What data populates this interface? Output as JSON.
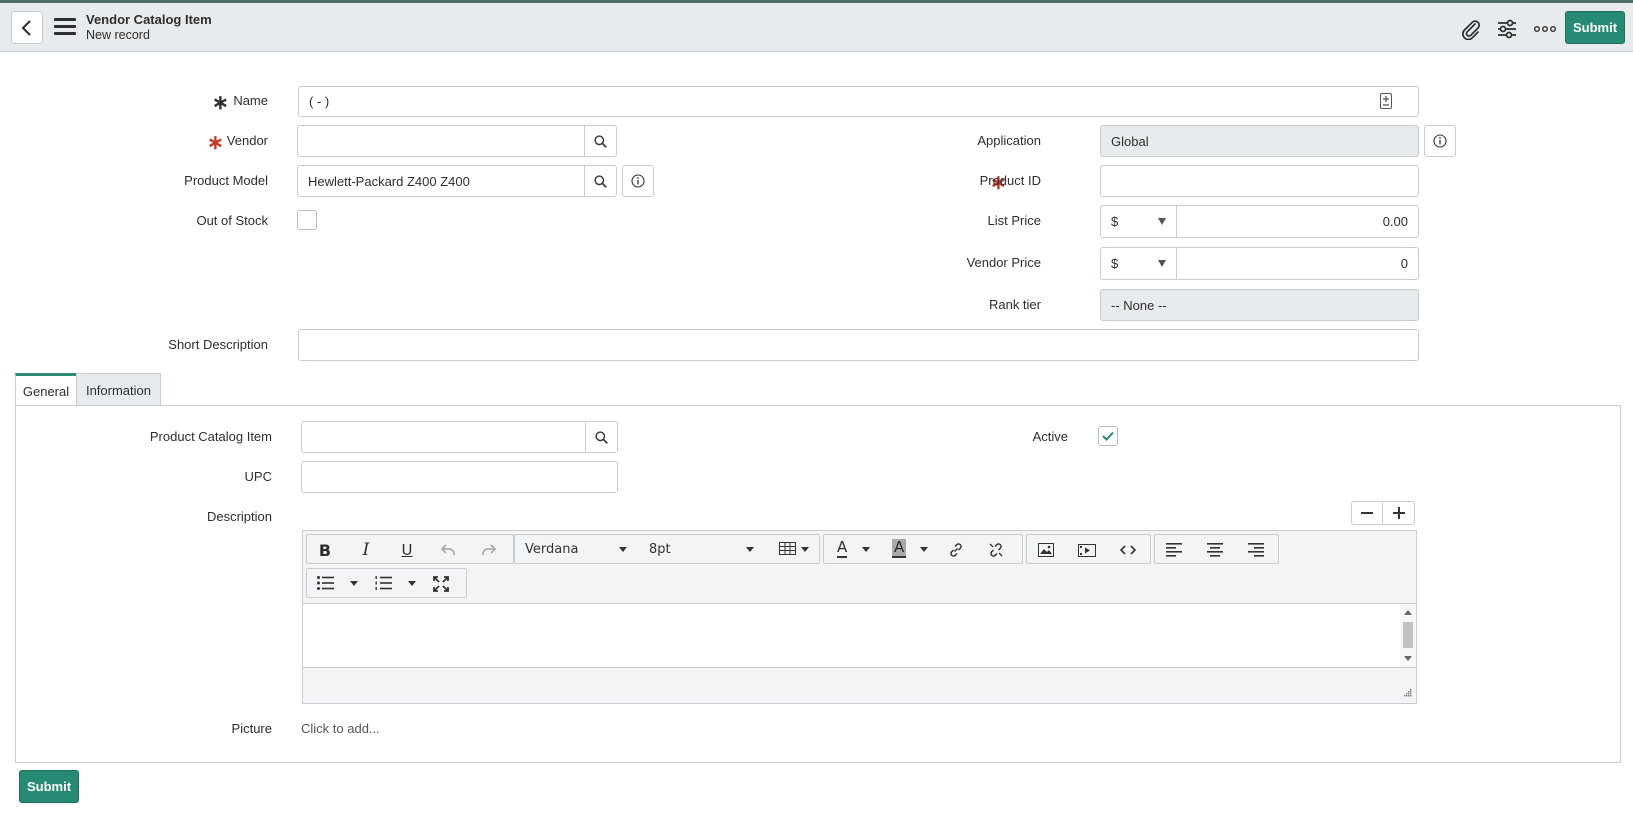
{
  "header": {
    "title": "Vendor Catalog Item",
    "subtitle": "New record",
    "submit_label": "Submit"
  },
  "form": {
    "name": {
      "label": "Name",
      "value": "( - )"
    },
    "vendor": {
      "label": "Vendor",
      "value": ""
    },
    "application": {
      "label": "Application",
      "value": "Global"
    },
    "product_model": {
      "label": "Product Model",
      "value": "Hewlett-Packard Z400 Z400"
    },
    "product_id": {
      "label": "Product ID",
      "value": ""
    },
    "out_of_stock": {
      "label": "Out of Stock",
      "checked": false
    },
    "list_price": {
      "label": "List Price",
      "currency": "$",
      "value": "0.00"
    },
    "vendor_price": {
      "label": "Vendor Price",
      "currency": "$",
      "value": "0"
    },
    "rank_tier": {
      "label": "Rank tier",
      "value": "-- None --"
    },
    "short_description": {
      "label": "Short Description",
      "value": ""
    }
  },
  "tabs": [
    {
      "label": "General",
      "active": true
    },
    {
      "label": "Information",
      "active": false
    }
  ],
  "general": {
    "product_catalog_item": {
      "label": "Product Catalog Item",
      "value": ""
    },
    "active": {
      "label": "Active",
      "checked": true
    },
    "upc": {
      "label": "UPC",
      "value": ""
    },
    "description": {
      "label": "Description"
    },
    "picture": {
      "label": "Picture",
      "value": "Click to add..."
    }
  },
  "editor": {
    "font_family": "Verdana",
    "font_size": "8pt"
  },
  "footer": {
    "submit_label": "Submit"
  },
  "colors": {
    "accent": "#278a74",
    "required": "#c0392b"
  }
}
